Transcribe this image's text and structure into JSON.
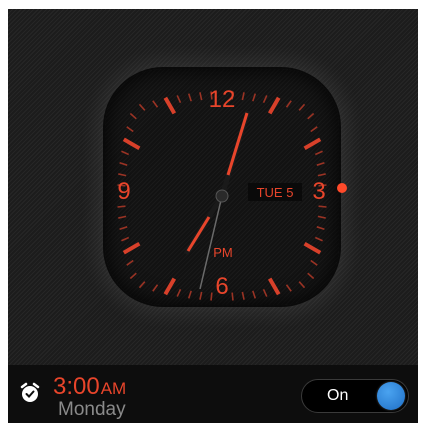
{
  "clock": {
    "numerals": {
      "twelve": "12",
      "three": "3",
      "six": "6",
      "nine": "9"
    },
    "date_label": "TUE 5",
    "meridiem": "PM",
    "accent_color": "#e8452b"
  },
  "alarm": {
    "icon": "alarm-clock-icon",
    "time": "3:00",
    "ampm": "AM",
    "day": "Monday",
    "toggle_label": "On",
    "toggle_knob_color": "#1f6fc6"
  }
}
